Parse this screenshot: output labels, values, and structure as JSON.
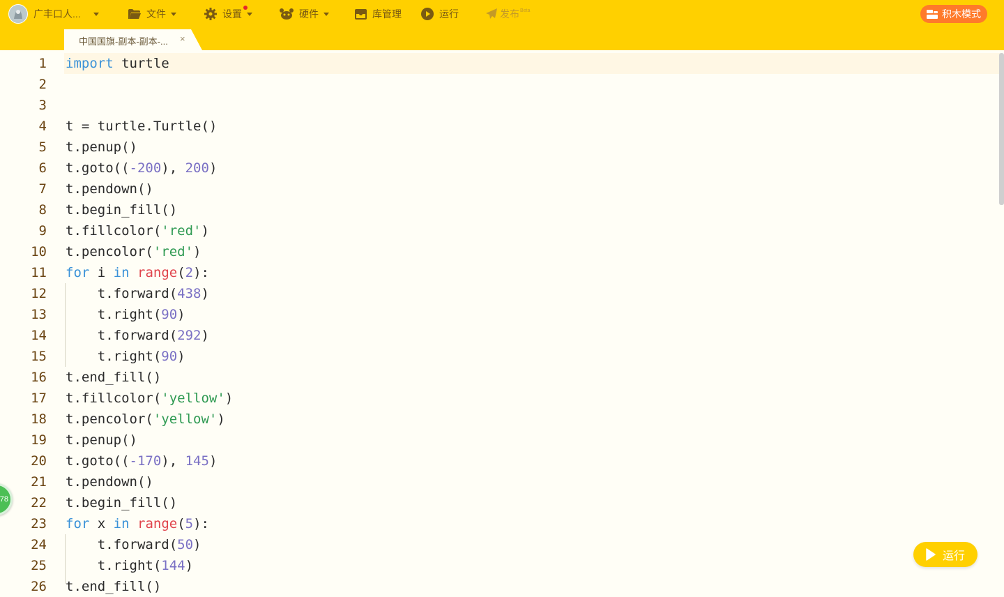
{
  "menu": {
    "user_label": "广丰口人...",
    "file_label": "文件",
    "settings_label": "设置",
    "hardware_label": "硬件",
    "library_label": "库管理",
    "run_label": "运行",
    "publish_label": "发布",
    "publish_badge": "Beta",
    "mode_label": "积木模式"
  },
  "tab": {
    "title": "中国国旗-副本-副本-...",
    "close": "×"
  },
  "editor": {
    "current_line": 1,
    "lines": [
      {
        "n": "1",
        "code": "<span class=\"kw\">import</span> turtle"
      },
      {
        "n": "2",
        "code": ""
      },
      {
        "n": "3",
        "code": ""
      },
      {
        "n": "4",
        "code": "t = turtle.Turtle()"
      },
      {
        "n": "5",
        "code": "t.penup()"
      },
      {
        "n": "6",
        "code": "t.goto((<span class=\"num\">-200</span>), <span class=\"num\">200</span>)"
      },
      {
        "n": "7",
        "code": "t.pendown()"
      },
      {
        "n": "8",
        "code": "t.begin_fill()"
      },
      {
        "n": "9",
        "code": "t.fillcolor(<span class=\"str\">'red'</span>)"
      },
      {
        "n": "10",
        "code": "t.pencolor(<span class=\"str\">'red'</span>)"
      },
      {
        "n": "11",
        "code": "<span class=\"kw\">for</span> i <span class=\"kw\">in</span> <span class=\"fn\">range</span>(<span class=\"num\">2</span>):"
      },
      {
        "n": "12",
        "code": "    t.forward(<span class=\"num\">438</span>)"
      },
      {
        "n": "13",
        "code": "    t.right(<span class=\"num\">90</span>)"
      },
      {
        "n": "14",
        "code": "    t.forward(<span class=\"num\">292</span>)"
      },
      {
        "n": "15",
        "code": "    t.right(<span class=\"num\">90</span>)"
      },
      {
        "n": "16",
        "code": "t.end_fill()"
      },
      {
        "n": "17",
        "code": "t.fillcolor(<span class=\"str\">'yellow'</span>)"
      },
      {
        "n": "18",
        "code": "t.pencolor(<span class=\"str\">'yellow'</span>)"
      },
      {
        "n": "19",
        "code": "t.penup()"
      },
      {
        "n": "20",
        "code": "t.goto((<span class=\"num\">-170</span>), <span class=\"num\">145</span>)"
      },
      {
        "n": "21",
        "code": "t.pendown()"
      },
      {
        "n": "22",
        "code": "t.begin_fill()"
      },
      {
        "n": "23",
        "code": "<span class=\"kw\">for</span> x <span class=\"kw\">in</span> <span class=\"fn\">range</span>(<span class=\"num\">5</span>):"
      },
      {
        "n": "24",
        "code": "    t.forward(<span class=\"num\">50</span>)"
      },
      {
        "n": "25",
        "code": "    t.right(<span class=\"num\">144</span>)"
      },
      {
        "n": "26",
        "code": "t.end_fill()"
      }
    ]
  },
  "float_badge": "78",
  "run_button_label": "运行",
  "colors": {
    "toolbar": "#ffd000",
    "mode_button": "#ff7a2a",
    "keyword": "#3b92d8",
    "builtin": "#e0444c",
    "number": "#7a70c4",
    "string": "#2f9a52",
    "line_number": "#6b4513"
  },
  "icons": [
    "avatar",
    "folder-icon",
    "gear-icon",
    "robot-icon",
    "inbox-icon",
    "play-circle-icon",
    "send-icon",
    "blocks-icon",
    "close-icon",
    "play-icon"
  ]
}
